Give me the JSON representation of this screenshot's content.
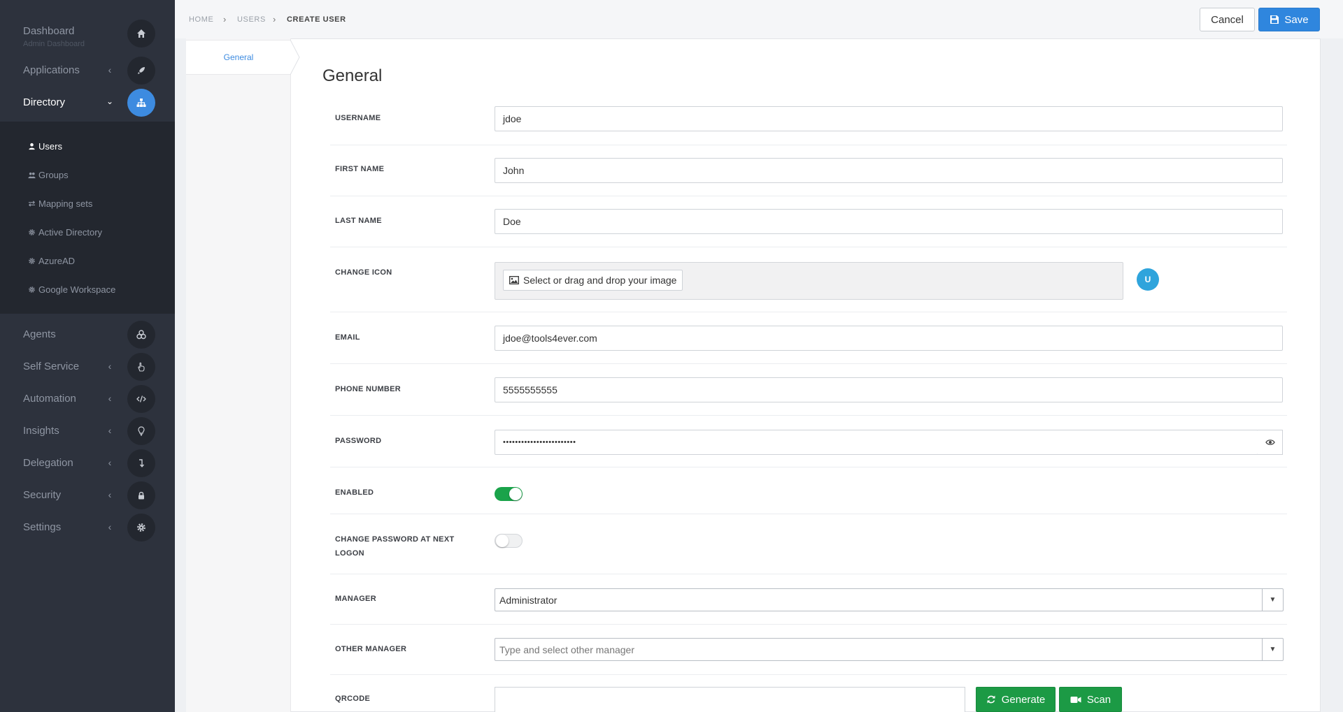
{
  "sidebar": {
    "items": [
      {
        "label": "Dashboard",
        "sub": "Admin Dashboard",
        "icon": "home-icon"
      },
      {
        "label": "Applications",
        "icon": "rocket-icon"
      },
      {
        "label": "Directory",
        "icon": "sitemap-icon"
      },
      {
        "label": "Agents",
        "icon": "cubes-icon"
      },
      {
        "label": "Self Service",
        "icon": "hand-pointer-icon"
      },
      {
        "label": "Automation",
        "icon": "code-icon"
      },
      {
        "label": "Insights",
        "icon": "lightbulb-icon"
      },
      {
        "label": "Delegation",
        "icon": "level-down-icon"
      },
      {
        "label": "Security",
        "icon": "lock-icon"
      },
      {
        "label": "Settings",
        "icon": "gear-icon"
      }
    ],
    "submenu": [
      {
        "label": "Users",
        "icon": "user-icon"
      },
      {
        "label": "Groups",
        "icon": "users-icon"
      },
      {
        "label": "Mapping sets",
        "icon": "exchange-icon"
      },
      {
        "label": "Active Directory",
        "icon": "cog-icon"
      },
      {
        "label": "AzureAD",
        "icon": "cog-icon"
      },
      {
        "label": "Google Workspace",
        "icon": "cog-icon"
      }
    ]
  },
  "breadcrumb": [
    "HOME",
    "USERS",
    "CREATE USER"
  ],
  "toolbar": {
    "cancel_label": "Cancel",
    "save_label": "Save"
  },
  "tabs": {
    "general": "General"
  },
  "form": {
    "title": "General",
    "username": {
      "label": "USERNAME",
      "value": "jdoe"
    },
    "first_name": {
      "label": "FIRST NAME",
      "value": "John"
    },
    "last_name": {
      "label": "LAST NAME",
      "value": "Doe"
    },
    "change_icon": {
      "label": "CHANGE ICON",
      "button": "Select or drag and drop your image",
      "avatar": "U"
    },
    "email": {
      "label": "EMAIL",
      "value": "jdoe@tools4ever.com"
    },
    "phone": {
      "label": "PHONE NUMBER",
      "value": "5555555555"
    },
    "password": {
      "label": "PASSWORD",
      "value": "••••••••••••••••••••••••"
    },
    "enabled": {
      "label": "ENABLED",
      "checked": true
    },
    "change_password": {
      "label_line1": "CHANGE PASSWORD AT NEXT",
      "label_line2": "LOGON",
      "checked": false
    },
    "manager": {
      "label": "MANAGER",
      "value": "Administrator"
    },
    "other_manager": {
      "label": "OTHER MANAGER",
      "placeholder": "Type and select other manager"
    },
    "qrcode": {
      "label": "QRCODE",
      "generate": "Generate",
      "scan": "Scan"
    }
  },
  "colors": {
    "accent": "#2f86de",
    "sidebar": "#2d323d",
    "success": "#1c9a45"
  }
}
